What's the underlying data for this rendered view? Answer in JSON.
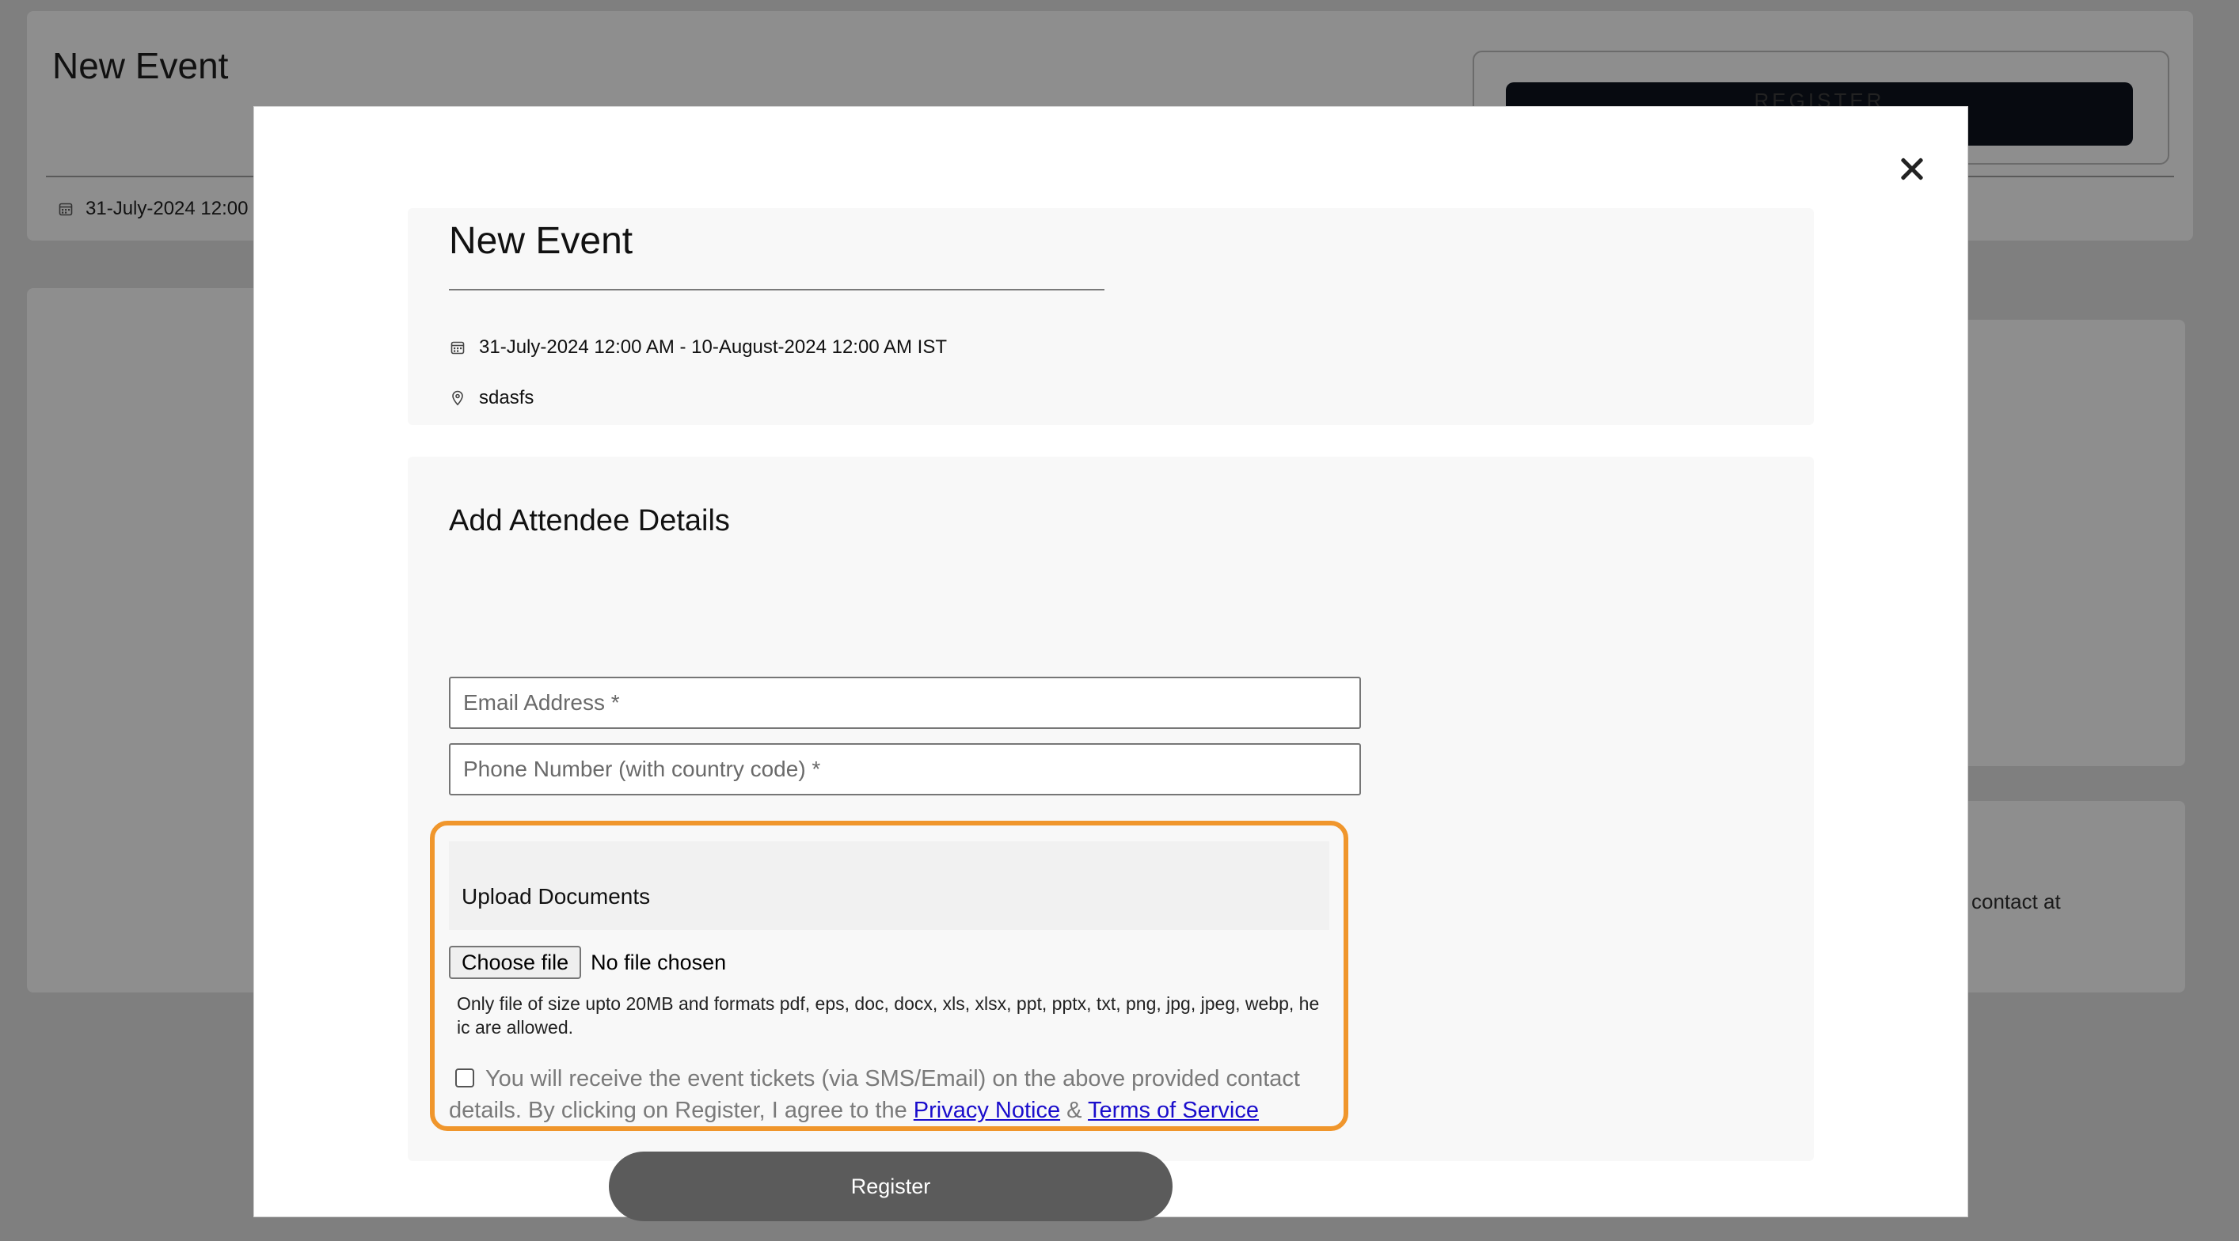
{
  "background": {
    "title": "New Event",
    "date_fragment": "31-July-2024 12:00",
    "register_fragment": "REGISTER",
    "contact_fragment": "contact at"
  },
  "modal": {
    "event": {
      "title": "New Event",
      "datetime": "31-July-2024 12:00 AM - 10-August-2024 12:00 AM IST",
      "location": "sdasfs"
    },
    "form": {
      "title": "Add Attendee Details",
      "email_placeholder": "Email Address *",
      "phone_placeholder": "Phone Number (with country code) *",
      "upload": {
        "title": "Upload Documents",
        "choose_label": "Choose file",
        "file_status": "No file chosen",
        "note": "Only file of size upto 20MB and formats pdf, eps, doc, docx, xls, xlsx, ppt, pptx, txt, png, jpg, jpeg, webp, heic are allowed."
      },
      "consent": {
        "text": "You will receive the event tickets (via SMS/Email) on the above provided contact details. By clicking on Register, I agree to the",
        "privacy_link": "Privacy Notice",
        "separator": "&",
        "terms_link": "Terms of Service"
      },
      "register_label": "Register"
    }
  },
  "colors": {
    "overlay": "#7f7f7f",
    "highlight": "#f0962c",
    "register_button": "#5b5b5b",
    "link": "#1a0dcc"
  }
}
